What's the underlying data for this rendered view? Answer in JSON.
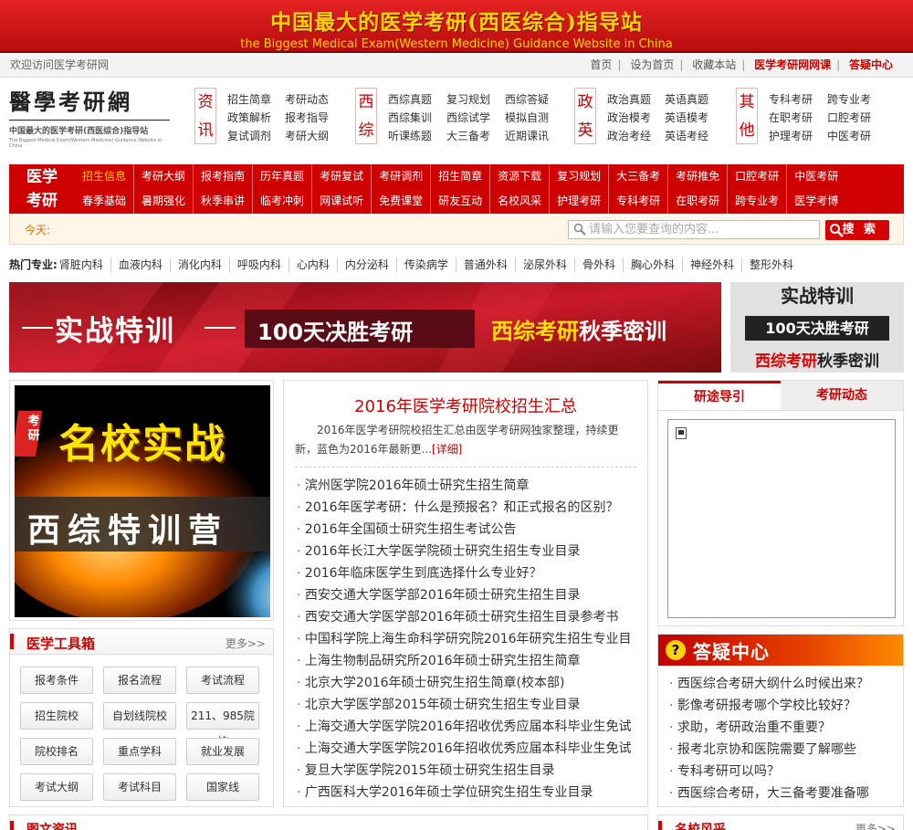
{
  "banner": {
    "title_cn": "中国最大的医学考研(西医综合)指导站",
    "title_en": "the Biggest Medical Exam(Western Medicine) Guidance Website in China"
  },
  "topbar": {
    "welcome": "欢迎访问医学考研网",
    "links": [
      "首页",
      "设为首页",
      "收藏本站",
      "医学考研网网课",
      "答疑中心"
    ]
  },
  "logo": {
    "title": "醫學考研網",
    "subtitle": "中国最大的医学考研(西医综合)指导站",
    "subtitle_en": "The Biggest Medical Exam(Western Medicine) Guidance Website in China"
  },
  "categories": [
    {
      "tag": [
        "资",
        "讯"
      ],
      "links": [
        "招生简章",
        "考研动态",
        "政策解析",
        "报考指导",
        "复试调剂",
        "考研大纲"
      ]
    },
    {
      "tag": [
        "西",
        "综"
      ],
      "links": [
        "西综真题",
        "复习规划",
        "西综答疑",
        "西综集训",
        "西综试学",
        "模拟自测",
        "听课练题",
        "大三备考",
        "近期课讯"
      ]
    },
    {
      "tag": [
        "政",
        "英"
      ],
      "links": [
        "政治真题",
        "英语真题",
        "政治模考",
        "英语模考",
        "政治考经",
        "英语考经"
      ]
    },
    {
      "tag": [
        "其",
        "他"
      ],
      "links": [
        "专科考研",
        "跨专业考",
        "在职考研",
        "口腔考研",
        "护理考研",
        "中医考研"
      ]
    }
  ],
  "nav": {
    "label": [
      "医学",
      "考研"
    ],
    "row1": [
      "招生信息",
      "考研大纲",
      "报考指南",
      "历年真题",
      "考研复试",
      "考研调剂",
      "招生简章",
      "资源下载",
      "复习规划",
      "大三备考",
      "考研推免",
      "口腔考研",
      "中医考研"
    ],
    "row2": [
      "春季基础",
      "暑期强化",
      "秋季串讲",
      "临考冲刺",
      "网课试听",
      "免费课堂",
      "研友互动",
      "名校风采",
      "护理考研",
      "专科考研",
      "在职考研",
      "跨专业考",
      "医学考博"
    ]
  },
  "search": {
    "today_label": "今天:",
    "placeholder": "请输入您要查询的内容...",
    "button": "搜 索"
  },
  "hot": {
    "label": "热门专业:",
    "items": [
      "肾脏内科",
      "血液内科",
      "消化内科",
      "呼吸内科",
      "心内科",
      "内分泌科",
      "传染病学",
      "普通外科",
      "泌尿外科",
      "骨外科",
      "胸心外科",
      "神经外科",
      "整形外科"
    ]
  },
  "banner_ad": {
    "left": "实战特训",
    "middle": "100天决胜考研",
    "right_a": "西综考研",
    "right_b": "秋季密训"
  },
  "banner_small": {
    "l1": "实战特训",
    "l2": "100天决胜考研",
    "l3a": "西综考研",
    "l3b": "秋季密训"
  },
  "promo": {
    "badge": "考研",
    "headline": "名校实战",
    "sub": "西综特训营"
  },
  "tools": {
    "title": "医学工具箱",
    "more": "更多>>",
    "buttons": [
      "报考条件",
      "报名流程",
      "考试流程",
      "招生院校",
      "自划线院校",
      "211、985院校",
      "院校排名",
      "重点学科",
      "就业发展",
      "考试大纲",
      "考试科目",
      "国家线"
    ]
  },
  "center": {
    "headline": "2016年医学考研院校招生汇总",
    "summary": "2016年医学考研院校招生汇总由医学考研网独家整理，持续更新，蓝色为2016年最新更...",
    "detail": "[详细]",
    "news": [
      "滨州医学院2016年硕士研究生招生简章",
      "2016年医学考研：什么是预报名？和正式报名的区别？",
      "2016年全国硕士研究生招生考试公告",
      "2016年长江大学医学院硕士研究生招生专业目录",
      "2016年临床医学生到底选择什么专业好？",
      "西安交通大学医学部2016年硕士研究生招生目录",
      "西安交通大学医学部2016年硕士研究生招生目录参考书",
      "中国科学院上海生命科学研究院2016年研究生招生专业目",
      "上海生物制品研究所2016年硕士研究生招生简章",
      "北京大学2016年硕士研究生招生简章(校本部)",
      "北京大学医学部2015年硕士研究生招生专业目录",
      "上海交通大学医学院2016年招收优秀应届本科毕业生免试",
      "上海交通大学医学院2016年招收优秀应届本科毕业生免试",
      "复旦大学医学院2015年硕士研究生招生目录",
      "广西医科大学2016年硕士学位研究生招生专业目录"
    ]
  },
  "rtabs": {
    "tab1": "研途导引",
    "tab2": "考研动态"
  },
  "faq": {
    "title": "答疑中心",
    "items": [
      "西医综合考研大纲什么时候出来？",
      "影像考研报考哪个学校比较好？",
      "求助，考研政治重不重要？",
      "报考北京协和医院需要了解哪些",
      "专科考研可以吗？",
      "西医综合考研，大三备考要准备哪"
    ]
  },
  "bottom": {
    "left_title": "图文资讯",
    "right_title": "名校风采",
    "right_more": "更多>>"
  },
  "colors": {
    "brand_red": "#cf0000",
    "accent_yellow": "#ffd600"
  }
}
